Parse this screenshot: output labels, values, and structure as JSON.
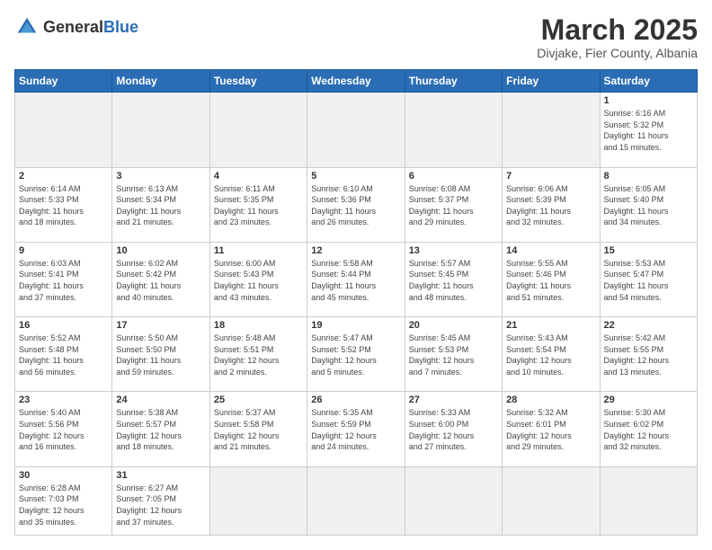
{
  "logo": {
    "text_general": "General",
    "text_blue": "Blue"
  },
  "header": {
    "month_title": "March 2025",
    "subtitle": "Divjake, Fier County, Albania"
  },
  "weekdays": [
    "Sunday",
    "Monday",
    "Tuesday",
    "Wednesday",
    "Thursday",
    "Friday",
    "Saturday"
  ],
  "weeks": [
    [
      {
        "day": "",
        "info": ""
      },
      {
        "day": "",
        "info": ""
      },
      {
        "day": "",
        "info": ""
      },
      {
        "day": "",
        "info": ""
      },
      {
        "day": "",
        "info": ""
      },
      {
        "day": "",
        "info": ""
      },
      {
        "day": "1",
        "info": "Sunrise: 6:16 AM\nSunset: 5:32 PM\nDaylight: 11 hours\nand 15 minutes."
      }
    ],
    [
      {
        "day": "2",
        "info": "Sunrise: 6:14 AM\nSunset: 5:33 PM\nDaylight: 11 hours\nand 18 minutes."
      },
      {
        "day": "3",
        "info": "Sunrise: 6:13 AM\nSunset: 5:34 PM\nDaylight: 11 hours\nand 21 minutes."
      },
      {
        "day": "4",
        "info": "Sunrise: 6:11 AM\nSunset: 5:35 PM\nDaylight: 11 hours\nand 23 minutes."
      },
      {
        "day": "5",
        "info": "Sunrise: 6:10 AM\nSunset: 5:36 PM\nDaylight: 11 hours\nand 26 minutes."
      },
      {
        "day": "6",
        "info": "Sunrise: 6:08 AM\nSunset: 5:37 PM\nDaylight: 11 hours\nand 29 minutes."
      },
      {
        "day": "7",
        "info": "Sunrise: 6:06 AM\nSunset: 5:39 PM\nDaylight: 11 hours\nand 32 minutes."
      },
      {
        "day": "8",
        "info": "Sunrise: 6:05 AM\nSunset: 5:40 PM\nDaylight: 11 hours\nand 34 minutes."
      }
    ],
    [
      {
        "day": "9",
        "info": "Sunrise: 6:03 AM\nSunset: 5:41 PM\nDaylight: 11 hours\nand 37 minutes."
      },
      {
        "day": "10",
        "info": "Sunrise: 6:02 AM\nSunset: 5:42 PM\nDaylight: 11 hours\nand 40 minutes."
      },
      {
        "day": "11",
        "info": "Sunrise: 6:00 AM\nSunset: 5:43 PM\nDaylight: 11 hours\nand 43 minutes."
      },
      {
        "day": "12",
        "info": "Sunrise: 5:58 AM\nSunset: 5:44 PM\nDaylight: 11 hours\nand 45 minutes."
      },
      {
        "day": "13",
        "info": "Sunrise: 5:57 AM\nSunset: 5:45 PM\nDaylight: 11 hours\nand 48 minutes."
      },
      {
        "day": "14",
        "info": "Sunrise: 5:55 AM\nSunset: 5:46 PM\nDaylight: 11 hours\nand 51 minutes."
      },
      {
        "day": "15",
        "info": "Sunrise: 5:53 AM\nSunset: 5:47 PM\nDaylight: 11 hours\nand 54 minutes."
      }
    ],
    [
      {
        "day": "16",
        "info": "Sunrise: 5:52 AM\nSunset: 5:48 PM\nDaylight: 11 hours\nand 56 minutes."
      },
      {
        "day": "17",
        "info": "Sunrise: 5:50 AM\nSunset: 5:50 PM\nDaylight: 11 hours\nand 59 minutes."
      },
      {
        "day": "18",
        "info": "Sunrise: 5:48 AM\nSunset: 5:51 PM\nDaylight: 12 hours\nand 2 minutes."
      },
      {
        "day": "19",
        "info": "Sunrise: 5:47 AM\nSunset: 5:52 PM\nDaylight: 12 hours\nand 5 minutes."
      },
      {
        "day": "20",
        "info": "Sunrise: 5:45 AM\nSunset: 5:53 PM\nDaylight: 12 hours\nand 7 minutes."
      },
      {
        "day": "21",
        "info": "Sunrise: 5:43 AM\nSunset: 5:54 PM\nDaylight: 12 hours\nand 10 minutes."
      },
      {
        "day": "22",
        "info": "Sunrise: 5:42 AM\nSunset: 5:55 PM\nDaylight: 12 hours\nand 13 minutes."
      }
    ],
    [
      {
        "day": "23",
        "info": "Sunrise: 5:40 AM\nSunset: 5:56 PM\nDaylight: 12 hours\nand 16 minutes."
      },
      {
        "day": "24",
        "info": "Sunrise: 5:38 AM\nSunset: 5:57 PM\nDaylight: 12 hours\nand 18 minutes."
      },
      {
        "day": "25",
        "info": "Sunrise: 5:37 AM\nSunset: 5:58 PM\nDaylight: 12 hours\nand 21 minutes."
      },
      {
        "day": "26",
        "info": "Sunrise: 5:35 AM\nSunset: 5:59 PM\nDaylight: 12 hours\nand 24 minutes."
      },
      {
        "day": "27",
        "info": "Sunrise: 5:33 AM\nSunset: 6:00 PM\nDaylight: 12 hours\nand 27 minutes."
      },
      {
        "day": "28",
        "info": "Sunrise: 5:32 AM\nSunset: 6:01 PM\nDaylight: 12 hours\nand 29 minutes."
      },
      {
        "day": "29",
        "info": "Sunrise: 5:30 AM\nSunset: 6:02 PM\nDaylight: 12 hours\nand 32 minutes."
      }
    ],
    [
      {
        "day": "30",
        "info": "Sunrise: 6:28 AM\nSunset: 7:03 PM\nDaylight: 12 hours\nand 35 minutes."
      },
      {
        "day": "31",
        "info": "Sunrise: 6:27 AM\nSunset: 7:05 PM\nDaylight: 12 hours\nand 37 minutes."
      },
      {
        "day": "",
        "info": ""
      },
      {
        "day": "",
        "info": ""
      },
      {
        "day": "",
        "info": ""
      },
      {
        "day": "",
        "info": ""
      },
      {
        "day": "",
        "info": ""
      }
    ]
  ]
}
